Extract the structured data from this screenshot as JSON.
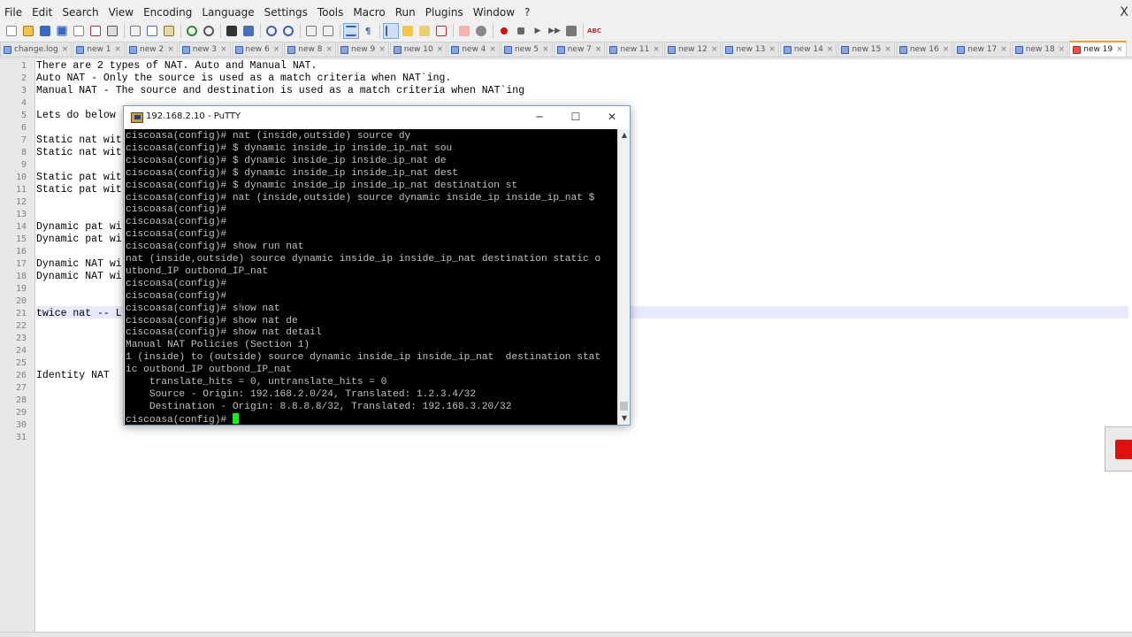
{
  "menu": [
    "File",
    "Edit",
    "Search",
    "View",
    "Encoding",
    "Language",
    "Settings",
    "Tools",
    "Macro",
    "Run",
    "Plugins",
    "Window",
    "?"
  ],
  "app_close": "X",
  "tabs": [
    {
      "label": "change.log",
      "x": "×"
    },
    {
      "label": "new 1",
      "x": "×"
    },
    {
      "label": "new 2",
      "x": "×"
    },
    {
      "label": "new 3",
      "x": "×"
    },
    {
      "label": "new 6",
      "x": "×"
    },
    {
      "label": "new 8",
      "x": "×"
    },
    {
      "label": "new 9",
      "x": "×"
    },
    {
      "label": "new 10",
      "x": "×"
    },
    {
      "label": "new 4",
      "x": "×"
    },
    {
      "label": "new 5",
      "x": "×"
    },
    {
      "label": "new 7",
      "x": "×"
    },
    {
      "label": "new 11",
      "x": "×"
    },
    {
      "label": "new 12",
      "x": "×"
    },
    {
      "label": "new 13",
      "x": "×"
    },
    {
      "label": "new 14",
      "x": "×"
    },
    {
      "label": "new 15",
      "x": "×"
    },
    {
      "label": "new 16",
      "x": "×"
    },
    {
      "label": "new 17",
      "x": "×"
    },
    {
      "label": "new 18",
      "x": "×"
    },
    {
      "label": "new 19",
      "x": "×",
      "active": true
    }
  ],
  "editor": {
    "line_numbers": [
      "1",
      "2",
      "3",
      "4",
      "5",
      "6",
      "7",
      "8",
      "9",
      "10",
      "11",
      "12",
      "13",
      "14",
      "15",
      "16",
      "17",
      "18",
      "19",
      "20",
      "21",
      "22",
      "23",
      "24",
      "25",
      "26",
      "27",
      "28",
      "29",
      "30",
      "31"
    ],
    "lines": [
      "There are 2 types of NAT. Auto and Manual NAT.",
      "Auto NAT - Only the source is used as a match criteria when NAT`ing.",
      "Manual NAT - The source and destination is used as a match criteria when NAT`ing",
      "",
      "Lets do below",
      "",
      "Static nat wit",
      "Static nat wit",
      "",
      "Static pat wit",
      "Static pat wit",
      "",
      "",
      "Dynamic pat wi",
      "Dynamic pat wi",
      "",
      "Dynamic NAT wi",
      "Dynamic NAT wi",
      "",
      "",
      "twice nat -- L",
      "",
      "",
      "",
      "",
      "Identity NAT",
      "",
      "",
      "",
      "",
      ""
    ]
  },
  "putty": {
    "title": "192.168.2.10 - PuTTY",
    "minimize": "─",
    "maximize": "☐",
    "close": "✕",
    "terminal_lines": [
      "ciscoasa(config)# nat (inside,outside) source dy",
      "ciscoasa(config)# $ dynamic inside_ip inside_ip_nat sou",
      "ciscoasa(config)# $ dynamic inside_ip inside_ip_nat de",
      "ciscoasa(config)# $ dynamic inside_ip inside_ip_nat dest",
      "ciscoasa(config)# $ dynamic inside_ip inside_ip_nat destination st",
      "ciscoasa(config)# nat (inside,outside) source dynamic inside_ip inside_ip_nat $",
      "ciscoasa(config)#",
      "ciscoasa(config)#",
      "ciscoasa(config)#",
      "ciscoasa(config)# show run nat",
      "nat (inside,outside) source dynamic inside_ip inside_ip_nat destination static o",
      "utbond_IP outbond_IP_nat",
      "ciscoasa(config)#",
      "ciscoasa(config)#",
      "ciscoasa(config)# show nat",
      "ciscoasa(config)# show nat de",
      "ciscoasa(config)# show nat detail",
      "Manual NAT Policies (Section 1)",
      "1 (inside) to (outside) source dynamic inside_ip inside_ip_nat  destination stat",
      "ic outbond_IP outbond_IP_nat",
      "    translate_hits = 0, untranslate_hits = 0",
      "    Source - Origin: 192.168.2.0/24, Translated: 1.2.3.4/32",
      "    Destination - Origin: 8.8.8.8/32, Translated: 192.168.3.20/32",
      "ciscoasa(config)# "
    ],
    "scroll_up": "▲",
    "scroll_down": "▼"
  }
}
